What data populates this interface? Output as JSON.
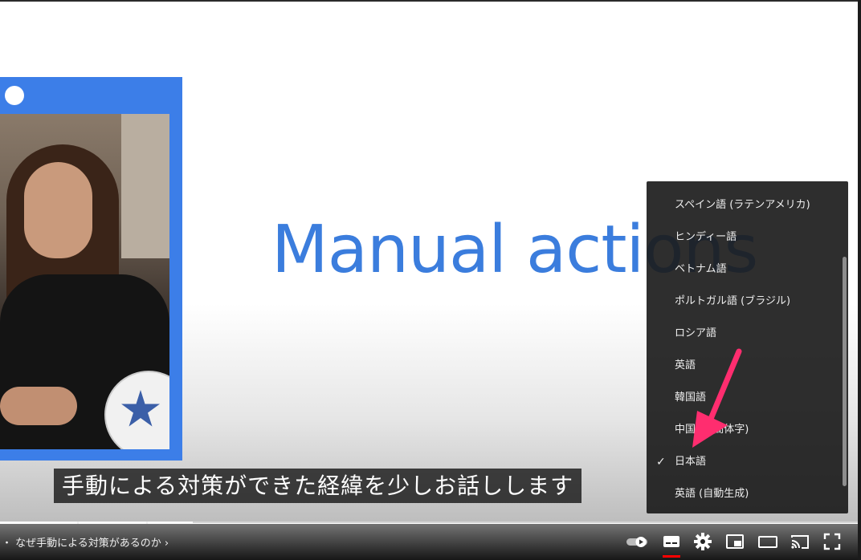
{
  "slide": {
    "title": "Manual actions",
    "accent_color": "#3b7ddd",
    "presenter_frame_color": "#3c7ee8"
  },
  "subtitle": "手動による対策ができた経緯を少しお話しします",
  "caption_menu": {
    "items": [
      {
        "label": "スペイン語 (ラテンアメリカ)",
        "selected": false
      },
      {
        "label": "ヒンディー語",
        "selected": false
      },
      {
        "label": "ベトナム語",
        "selected": false
      },
      {
        "label": "ポルトガル語 (ブラジル)",
        "selected": false
      },
      {
        "label": "ロシア語",
        "selected": false
      },
      {
        "label": "英語",
        "selected": false
      },
      {
        "label": "韓国語",
        "selected": false
      },
      {
        "label": "中国語 (簡体字)",
        "selected": false
      },
      {
        "label": "日本語",
        "selected": true
      },
      {
        "label": "英語 (自動生成)",
        "selected": false
      }
    ],
    "check_mark": "✓"
  },
  "annotation_arrow_color": "#ff2d6f",
  "control_bar": {
    "chapter_label": "・ なぜ手動による対策があるのか ›",
    "icons": [
      "autoplay-toggle-icon",
      "subtitles-icon",
      "settings-gear-icon",
      "miniplayer-icon",
      "theater-mode-icon",
      "cast-icon",
      "fullscreen-icon"
    ],
    "captions_active_color": "#ff0000"
  }
}
